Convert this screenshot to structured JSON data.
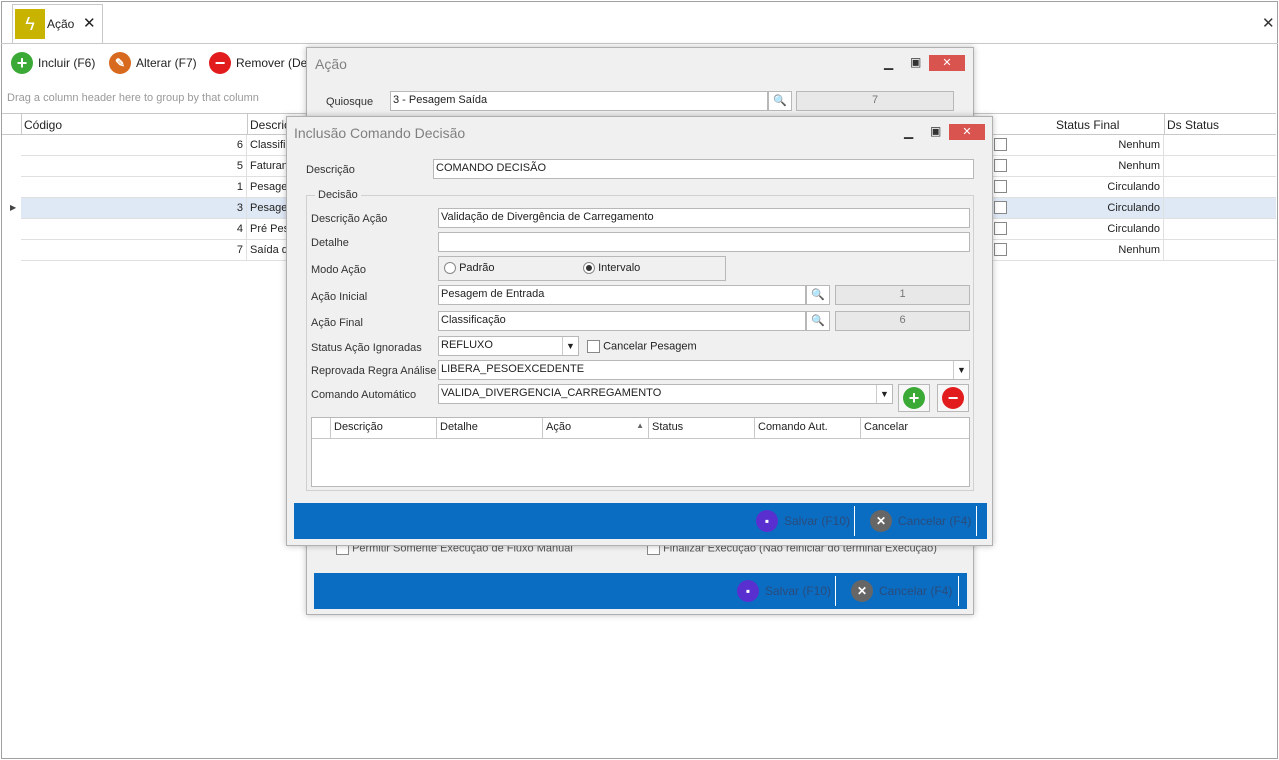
{
  "tab": {
    "title": "Ação",
    "icon": "lightning-icon",
    "close": "✕"
  },
  "window_close": "✕",
  "toolbar": {
    "incluir": "Incluir (F6)",
    "alterar": "Alterar (F7)",
    "remover": "Remover (De"
  },
  "grid": {
    "group_hint": "Drag a column header here to group by that column",
    "headers": {
      "codigo": "Código",
      "descricao": "Descriç",
      "status_final": "Status Final",
      "ds_status": "Ds Status"
    },
    "rows": [
      {
        "codigo": "6",
        "descricao": "Classific",
        "status_final": "Nenhum"
      },
      {
        "codigo": "5",
        "descricao": "Faturan",
        "status_final": "Nenhum"
      },
      {
        "codigo": "1",
        "descricao": "Pesage",
        "status_final": "Circulando"
      },
      {
        "codigo": "3",
        "descricao": "Pesage",
        "status_final": "Circulando"
      },
      {
        "codigo": "4",
        "descricao": "Pré Pes",
        "status_final": "Circulando"
      },
      {
        "codigo": "7",
        "descricao": "Saída d",
        "status_final": "Nenhum"
      }
    ]
  },
  "acao_dialog": {
    "title": "Ação",
    "quiosque_label": "Quiosque",
    "quiosque_value": "3 - Pesagem Saída",
    "quiosque_code": "7",
    "hidden_check1": "Permitir Somente Execução de Fluxo Manual",
    "hidden_check2": "Finalizar Execução (Não reiniciar do terminal Execução)",
    "salvar": "Salvar (F10)",
    "cancelar": "Cancelar (F4)"
  },
  "inclusao_dialog": {
    "title": "Inclusão Comando Decisão",
    "descricao_label": "Descrição",
    "descricao_value": "COMANDO DECISÃO",
    "group_label": "Decisão",
    "descricao_acao_label": "Descrição Ação",
    "descricao_acao_value": "Validação de Divergência de Carregamento",
    "detalhe_label": "Detalhe",
    "detalhe_value": "",
    "modo_acao_label": "Modo Ação",
    "modo_padrao": "Padrão",
    "modo_intervalo": "Intervalo",
    "acao_inicial_label": "Ação Inicial",
    "acao_inicial_value": "Pesagem de Entrada",
    "acao_inicial_code": "1",
    "acao_final_label": "Ação Final",
    "acao_final_value": "Classificação",
    "acao_final_code": "6",
    "status_ignoradas_label": "Status Ação Ignoradas",
    "status_ignoradas_value": "REFLUXO",
    "cancelar_pesagem_label": "Cancelar Pesagem",
    "reprovada_label": "Reprovada Regra Análise",
    "reprovada_value": "LIBERA_PESOEXCEDENTE",
    "comando_auto_label": "Comando Automático",
    "comando_auto_value": "VALIDA_DIVERGENCIA_CARREGAMENTO",
    "subgrid_headers": [
      "Descrição",
      "Detalhe",
      "Ação",
      "Status",
      "Comando Aut.",
      "Cancelar"
    ],
    "salvar": "Salvar (F10)",
    "cancelar": "Cancelar (F4)"
  },
  "colors": {
    "footer": "#0a6dc2",
    "add": "#3aa935",
    "remove": "#e21c1c",
    "tab_icon": "#c8b400",
    "selected_row": "#dfe9f5"
  }
}
